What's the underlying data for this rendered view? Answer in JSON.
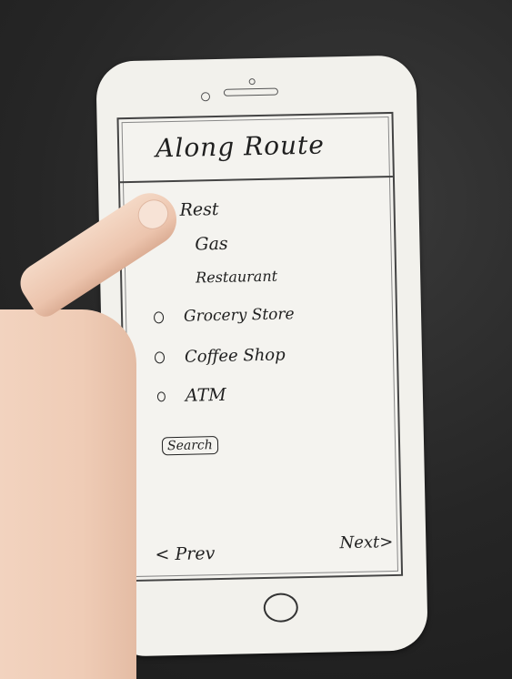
{
  "screen": {
    "title": "Along Route",
    "options": [
      {
        "label": "Rest"
      },
      {
        "label": "Gas"
      },
      {
        "label": "Restaurant"
      },
      {
        "label": "Grocery Store"
      },
      {
        "label": "Coffee Shop"
      },
      {
        "label": "ATM"
      }
    ],
    "search_label": "Search",
    "prev_label": "< Prev",
    "next_label": "Next>"
  }
}
